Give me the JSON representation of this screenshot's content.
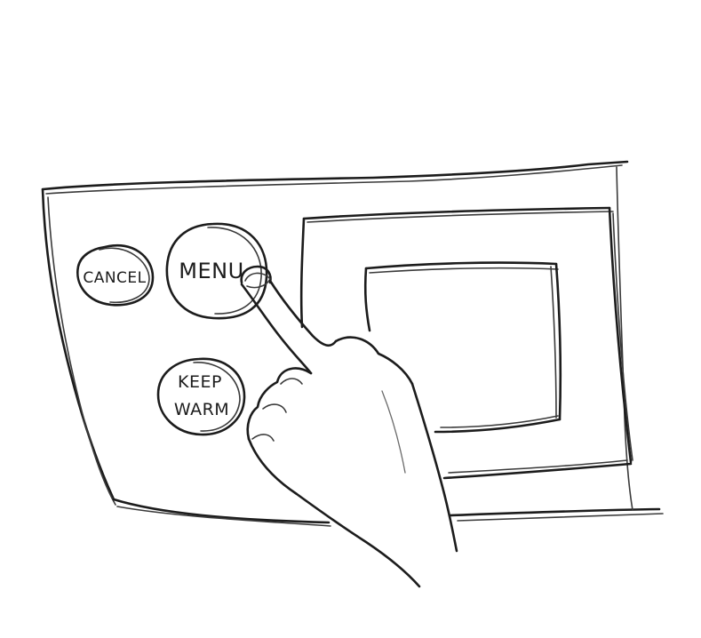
{
  "panel": {
    "buttons": {
      "cancel": {
        "label": "CANCEL"
      },
      "menu": {
        "label": "MENU"
      },
      "keep_warm": {
        "line1": "KEEP",
        "line2": "WARM"
      }
    }
  },
  "icons": {
    "finger": "pointing-hand-icon"
  },
  "colors": {
    "ink": "#1c1c1c",
    "paper": "#ffffff"
  }
}
